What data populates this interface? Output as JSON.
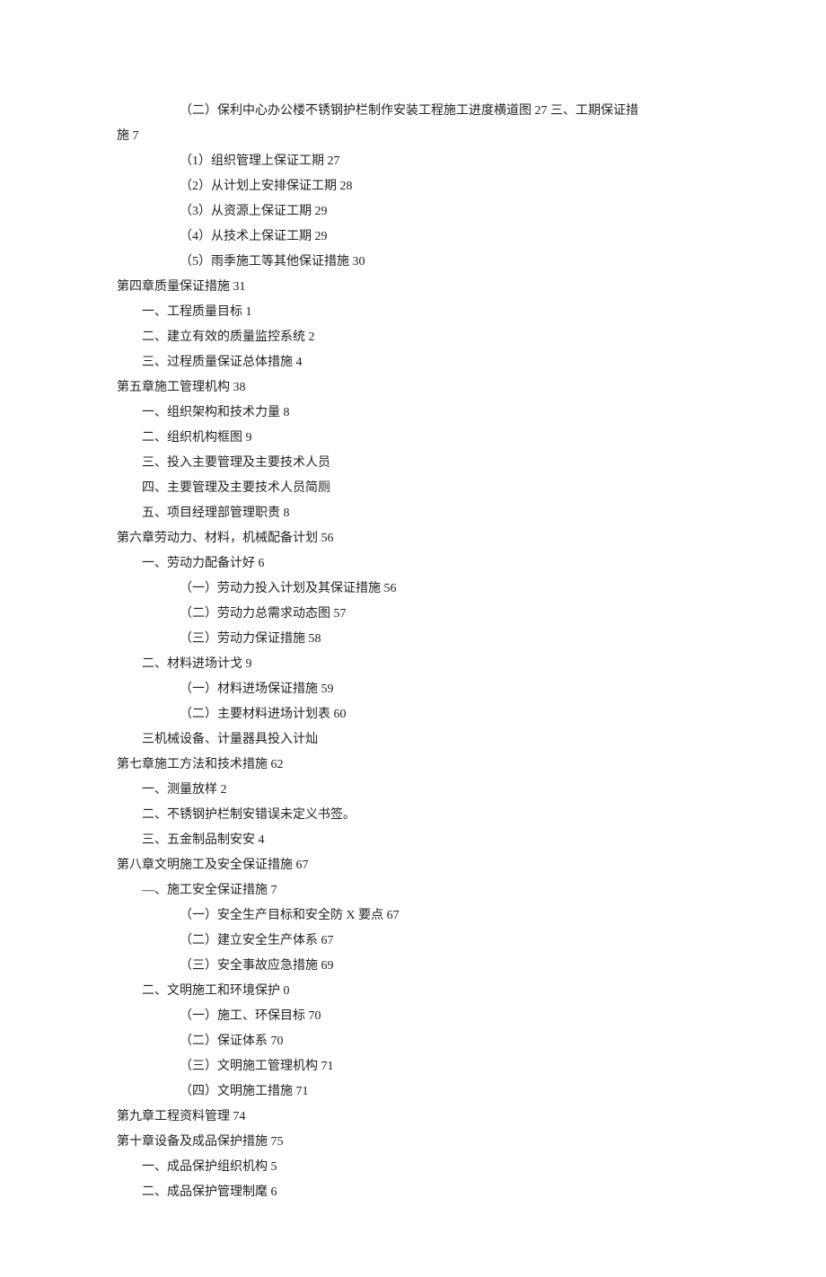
{
  "lines": [
    {
      "cls": "l2",
      "text": "（二）保利中心办公楼不锈钢护栏制作安装工程施工进度横道图 27 三、工期保证措"
    },
    {
      "cls": "cont",
      "text": "施 7"
    },
    {
      "cls": "l2",
      "text": "（1）组织管理上保证工期 27"
    },
    {
      "cls": "l2",
      "text": "（2）从计划上安排保证工期 28"
    },
    {
      "cls": "l2",
      "text": "（3）从资源上保证工期 29"
    },
    {
      "cls": "l2",
      "text": "（4）从技术上保证工期 29"
    },
    {
      "cls": "l2",
      "text": "（5）雨季施工等其他保证措施 30"
    },
    {
      "cls": "l0",
      "text": "第四章质量保证措施 31"
    },
    {
      "cls": "l1",
      "text": "一、工程质量目标 1"
    },
    {
      "cls": "l1",
      "text": "二、建立有效的质量监控系统 2"
    },
    {
      "cls": "l1",
      "text": "三、过程质量保证总体措施 4"
    },
    {
      "cls": "l0",
      "text": "第五章施工管理机构 38"
    },
    {
      "cls": "l1",
      "text": "一、组织架构和技术力量 8"
    },
    {
      "cls": "l1",
      "text": "二、组织机构框图 9"
    },
    {
      "cls": "l1",
      "text": "三、投入主要管理及主要技术人员"
    },
    {
      "cls": "l1",
      "text": "四、主要管理及主要技术人员简厕"
    },
    {
      "cls": "l1",
      "text": "五、项目经理部管理职责 8"
    },
    {
      "cls": "l0",
      "text": "第六章劳动力、材料，机械配备计划 56"
    },
    {
      "cls": "l1",
      "text": "一、劳动力配备计好 6"
    },
    {
      "cls": "l2",
      "text": "（一）劳动力投入计划及其保证措施 56"
    },
    {
      "cls": "l2",
      "text": "（二）劳动力总需求动态图 57"
    },
    {
      "cls": "l2",
      "text": "（三）劳动力保证措施 58"
    },
    {
      "cls": "l1",
      "text": "二、材料进场计戈 9"
    },
    {
      "cls": "l2",
      "text": "（一）材料进场保证措施 59"
    },
    {
      "cls": "l2",
      "text": "（二）主要材料进场计划表 60"
    },
    {
      "cls": "l1",
      "text": "三机械设备、计量器具投入计灿"
    },
    {
      "cls": "l0",
      "text": "第七章施工方法和技术措施 62"
    },
    {
      "cls": "l1",
      "text": "一、测量放样 2"
    },
    {
      "cls": "l1",
      "text": "二、不锈钢护栏制安错误未定义书签。"
    },
    {
      "cls": "l1",
      "text": "三、五金制品制安安 4"
    },
    {
      "cls": "l0",
      "text": "第八章文明施工及安全保证措施 67"
    },
    {
      "cls": "l1",
      "text": "—、施工安全保证措施 7"
    },
    {
      "cls": "l2",
      "text": "（一）安全生产目标和安全防 X 要点 67"
    },
    {
      "cls": "l2",
      "text": "（二）建立安全生产体系 67"
    },
    {
      "cls": "l2",
      "text": "（三）安全事故应急措施 69"
    },
    {
      "cls": "l1",
      "text": "二、文明施工和环境保护 0"
    },
    {
      "cls": "l2",
      "text": "（一）施工、环保目标 70"
    },
    {
      "cls": "l2",
      "text": "（二）保证体系 70"
    },
    {
      "cls": "l2",
      "text": "（三）文明施工管理机构 71"
    },
    {
      "cls": "l2",
      "text": "（四）文明施工措施 71"
    },
    {
      "cls": "l0",
      "text": "第九章工程资料管理 74"
    },
    {
      "cls": "l0",
      "text": "第十章设备及成品保护措施 75"
    },
    {
      "cls": "l1",
      "text": "一、成品保护组织机构 5"
    },
    {
      "cls": "l1",
      "text": "二、成品保护管理制麾 6"
    }
  ]
}
